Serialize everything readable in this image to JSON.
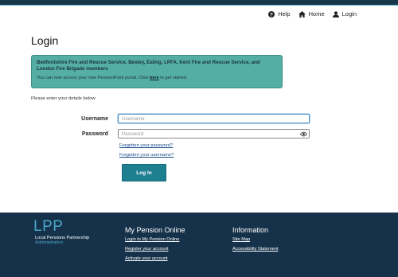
{
  "nav": {
    "help_label": "Help",
    "home_label": "Home",
    "login_label": "Login"
  },
  "page_title": "Login",
  "notice": {
    "title": "Bedfordshire Fire and Rescue Service, Bexley, Ealing, LPFA, Kent Fire and Rescue Service, and London Fire Brigade members",
    "body_before": "You can now access your new PensionPoint portal. Click ",
    "body_link": "here",
    "body_after": " to get started."
  },
  "intro": "Please enter your details below.",
  "form": {
    "username_label": "Username",
    "username_placeholder": "Username",
    "password_label": "Password",
    "password_placeholder": "Password",
    "forgot_password": "Forgotten your password?",
    "forgot_username": "Forgotten your username?",
    "submit_label": "Log In"
  },
  "footer": {
    "logo_text": "LPP",
    "logo_line1": "Local Pensions Partnership",
    "logo_line2": "Administration",
    "col1": {
      "heading": "My Pension Online",
      "links": [
        "Login to My Pension Online",
        "Register your account",
        "Activate your account"
      ]
    },
    "col2": {
      "heading": "Information",
      "links": [
        "Site Map",
        "Accessibility Statement"
      ]
    }
  },
  "colors": {
    "header_bar": "#17364a",
    "notice_bg": "#55aea3",
    "button_bg": "#1d7f8f",
    "footer_bg": "#16324a",
    "logo_accent": "#4ba6c8"
  }
}
